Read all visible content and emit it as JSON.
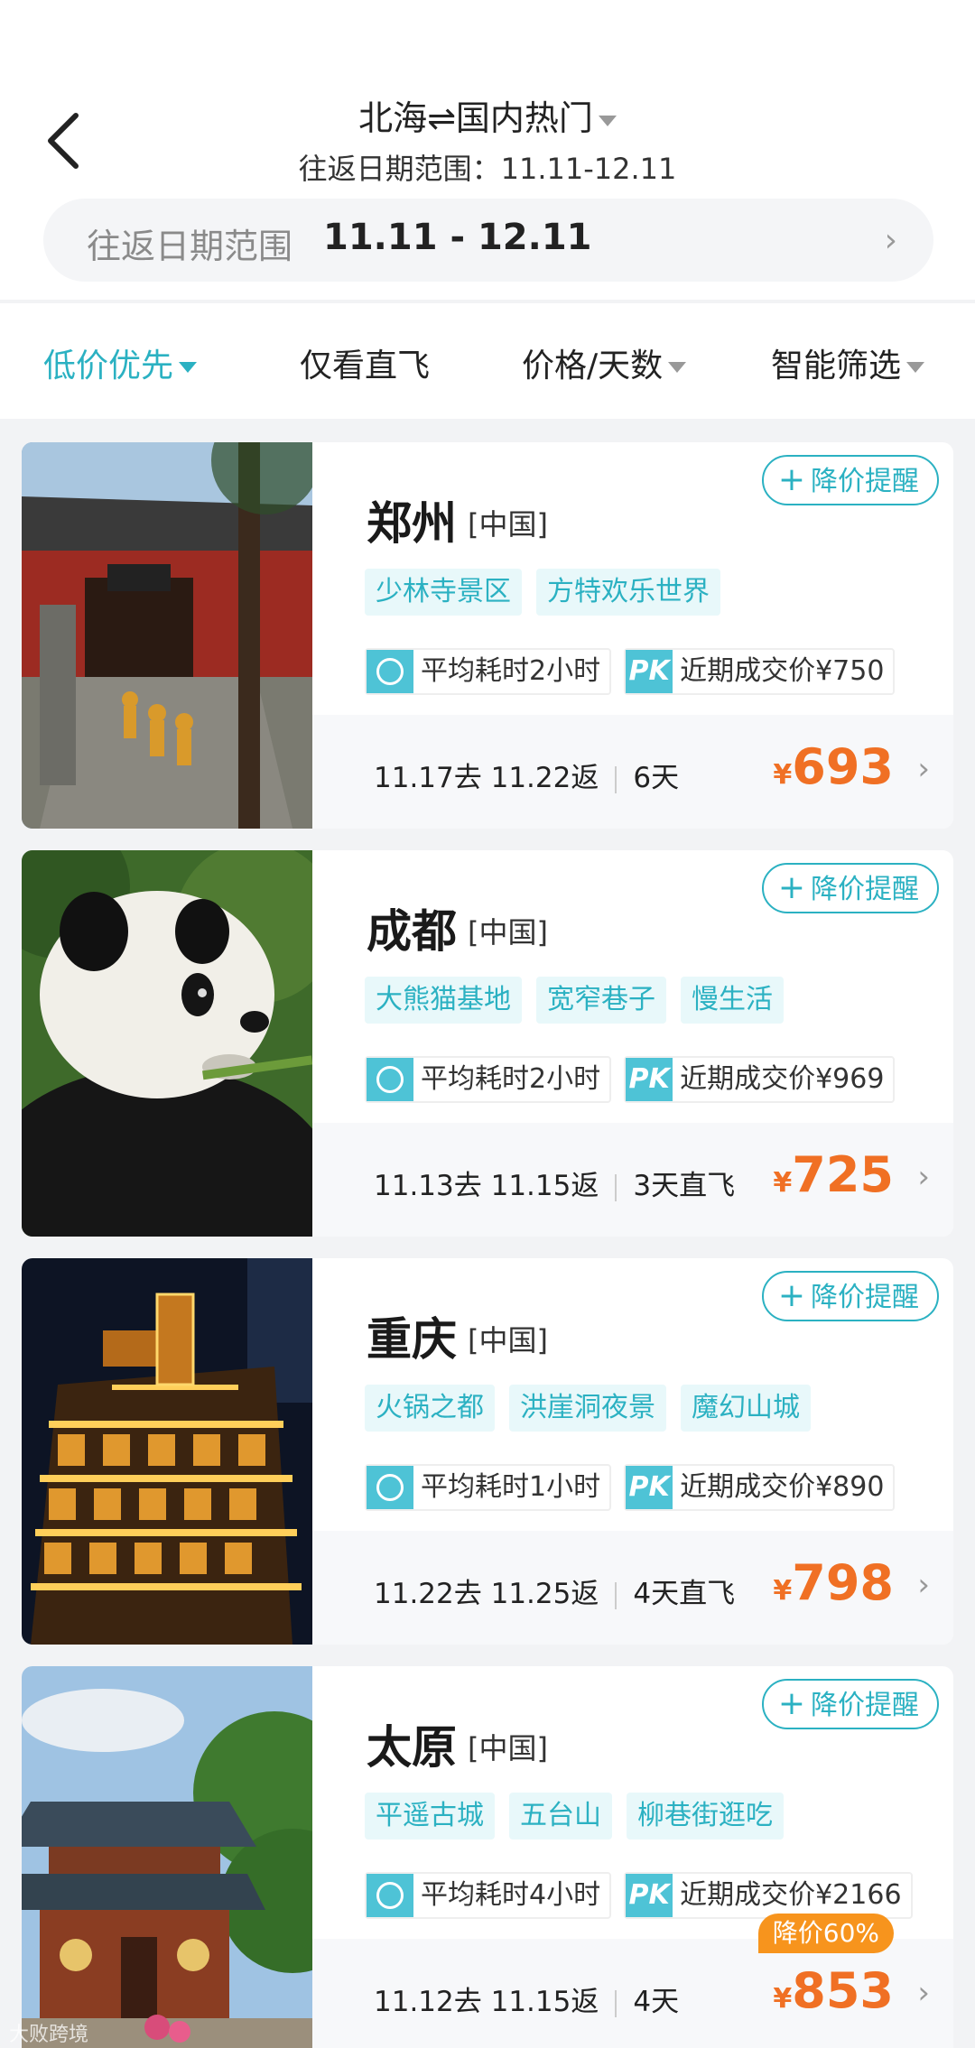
{
  "header": {
    "title": "北海⇌国内热门",
    "subtitle": "往返日期范围：11.11-12.11",
    "date_range_label": "往返日期范围",
    "date_range_value": "11.11 - 12.11"
  },
  "filters": [
    {
      "label": "低价优先",
      "active": true,
      "dropdown": true
    },
    {
      "label": "仅看直飞",
      "active": false,
      "dropdown": false
    },
    {
      "label": "价格/天数",
      "active": false,
      "dropdown": true
    },
    {
      "label": "智能筛选",
      "active": false,
      "dropdown": true
    }
  ],
  "alert_label": "降价提醒",
  "currency": "¥",
  "cards": [
    {
      "city": "郑州",
      "country": "[中国]",
      "tags": [
        "少林寺景区",
        "方特欢乐世界"
      ],
      "avg_time": "平均耗时2小时",
      "pk_label": "PK",
      "recent_price": "近期成交价¥750",
      "depart": "11.17去",
      "return": "11.22返",
      "duration": "6天",
      "price": "693"
    },
    {
      "city": "成都",
      "country": "[中国]",
      "tags": [
        "大熊猫基地",
        "宽窄巷子",
        "慢生活"
      ],
      "avg_time": "平均耗时2小时",
      "pk_label": "PK",
      "recent_price": "近期成交价¥969",
      "depart": "11.13去",
      "return": "11.15返",
      "duration": "3天直飞",
      "price": "725"
    },
    {
      "city": "重庆",
      "country": "[中国]",
      "tags": [
        "火锅之都",
        "洪崖洞夜景",
        "魔幻山城"
      ],
      "avg_time": "平均耗时1小时",
      "pk_label": "PK",
      "recent_price": "近期成交价¥890",
      "depart": "11.22去",
      "return": "11.25返",
      "duration": "4天直飞",
      "price": "798"
    },
    {
      "city": "太原",
      "country": "[中国]",
      "tags": [
        "平遥古城",
        "五台山",
        "柳巷街逛吃"
      ],
      "avg_time": "平均耗时4小时",
      "pk_label": "PK",
      "recent_price": "近期成交价¥2166",
      "depart": "11.12去",
      "return": "11.15返",
      "duration": "4天",
      "price": "853",
      "discount": "降价60%"
    }
  ],
  "watermark": "大败跨境",
  "colors": {
    "accent": "#2bb1c2",
    "price": "#f07024",
    "discount": "#f7941d"
  }
}
